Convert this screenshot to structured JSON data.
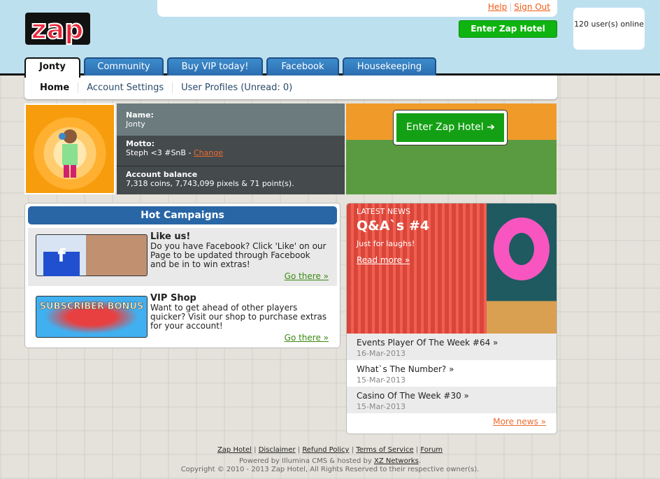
{
  "header": {
    "help": "Help",
    "sign_out": "Sign Out",
    "logo": "zap",
    "enter_button": "Enter Zap Hotel",
    "online": "120 user(s) online"
  },
  "tabs": [
    {
      "label": "Jonty",
      "active": true
    },
    {
      "label": "Community"
    },
    {
      "label": "Buy VIP today!"
    },
    {
      "label": "Facebook"
    },
    {
      "label": "Housekeeping"
    }
  ],
  "subnav": [
    "Home",
    "Account Settings",
    "User Profiles (Unread: 0)"
  ],
  "profile": {
    "name_label": "Name:",
    "name": "Jonty",
    "motto_label": "Motto:",
    "motto": "Steph <3 #SnB - ",
    "change": "Change",
    "balance_label": "Account balance",
    "balance": "7,318 coins, 7,743,099 pixels & 71 point(s).",
    "enter_button": "Enter Zap Hotel"
  },
  "campaigns": {
    "title": "Hot Campaigns",
    "items": [
      {
        "title": "Like us!",
        "text": "Do you have Facebook? Click 'Like' on our Page to be updated through Facebook and be in to win extras!",
        "link": "Go there »"
      },
      {
        "title": "VIP Shop",
        "text": "Want to get ahead of other players quicker? Visit our shop to purchase extras for your account!",
        "link": "Go there »",
        "banner": "SUBSCRIBER BONUS"
      }
    ]
  },
  "news": {
    "label": "LATEST NEWS",
    "headline": "Q&A`s #4",
    "summary": "Just for laughs!",
    "read_more": "Read more »",
    "items": [
      {
        "title": "Events Player Of The Week #64 »",
        "date": "16-Mar-2013"
      },
      {
        "title": "What`s The Number? »",
        "date": "15-Mar-2013"
      },
      {
        "title": "Casino Of The Week #30 »",
        "date": "15-Mar-2013"
      }
    ],
    "more": "More news »"
  },
  "footer": {
    "links": [
      "Zap Hotel",
      "Disclaimer",
      "Refund Policy",
      "Terms of Service",
      "Forum"
    ],
    "powered": "Powered by Illumina CMS & hosted by ",
    "host": "XZ Networks",
    "copyright": "Copyright © 2010 - 2013 Zap Hotel, All Rights Reserved to their respective owner(s)."
  }
}
